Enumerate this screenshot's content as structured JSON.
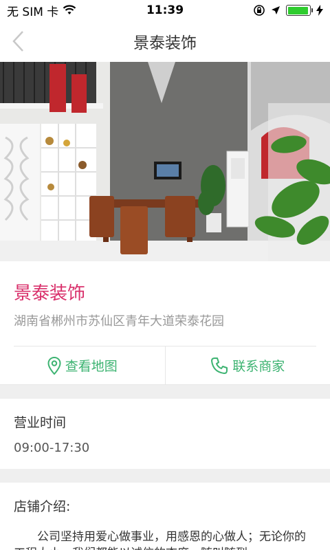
{
  "status_bar": {
    "carrier": "无 SIM 卡",
    "time": "11:39",
    "battery_level": 0.95
  },
  "nav": {
    "title": "景泰装饰",
    "back_icon": "chevron-left-icon"
  },
  "shop": {
    "name": "景泰装饰",
    "address": "湖南省郴州市苏仙区青年大道荣泰花园"
  },
  "actions": {
    "map_label": "查看地图",
    "contact_label": "联系商家"
  },
  "hours": {
    "title": "营业时间",
    "value": "09:00-17:30"
  },
  "intro": {
    "title": "店铺介绍:",
    "text": "公司坚持用爱心做事业，用感恩的心做人；无论你的工程大小，我们都能以诚信的态度，随叫随到。"
  },
  "colors": {
    "accent_pink": "#d9306b",
    "action_green": "#3cb371"
  }
}
